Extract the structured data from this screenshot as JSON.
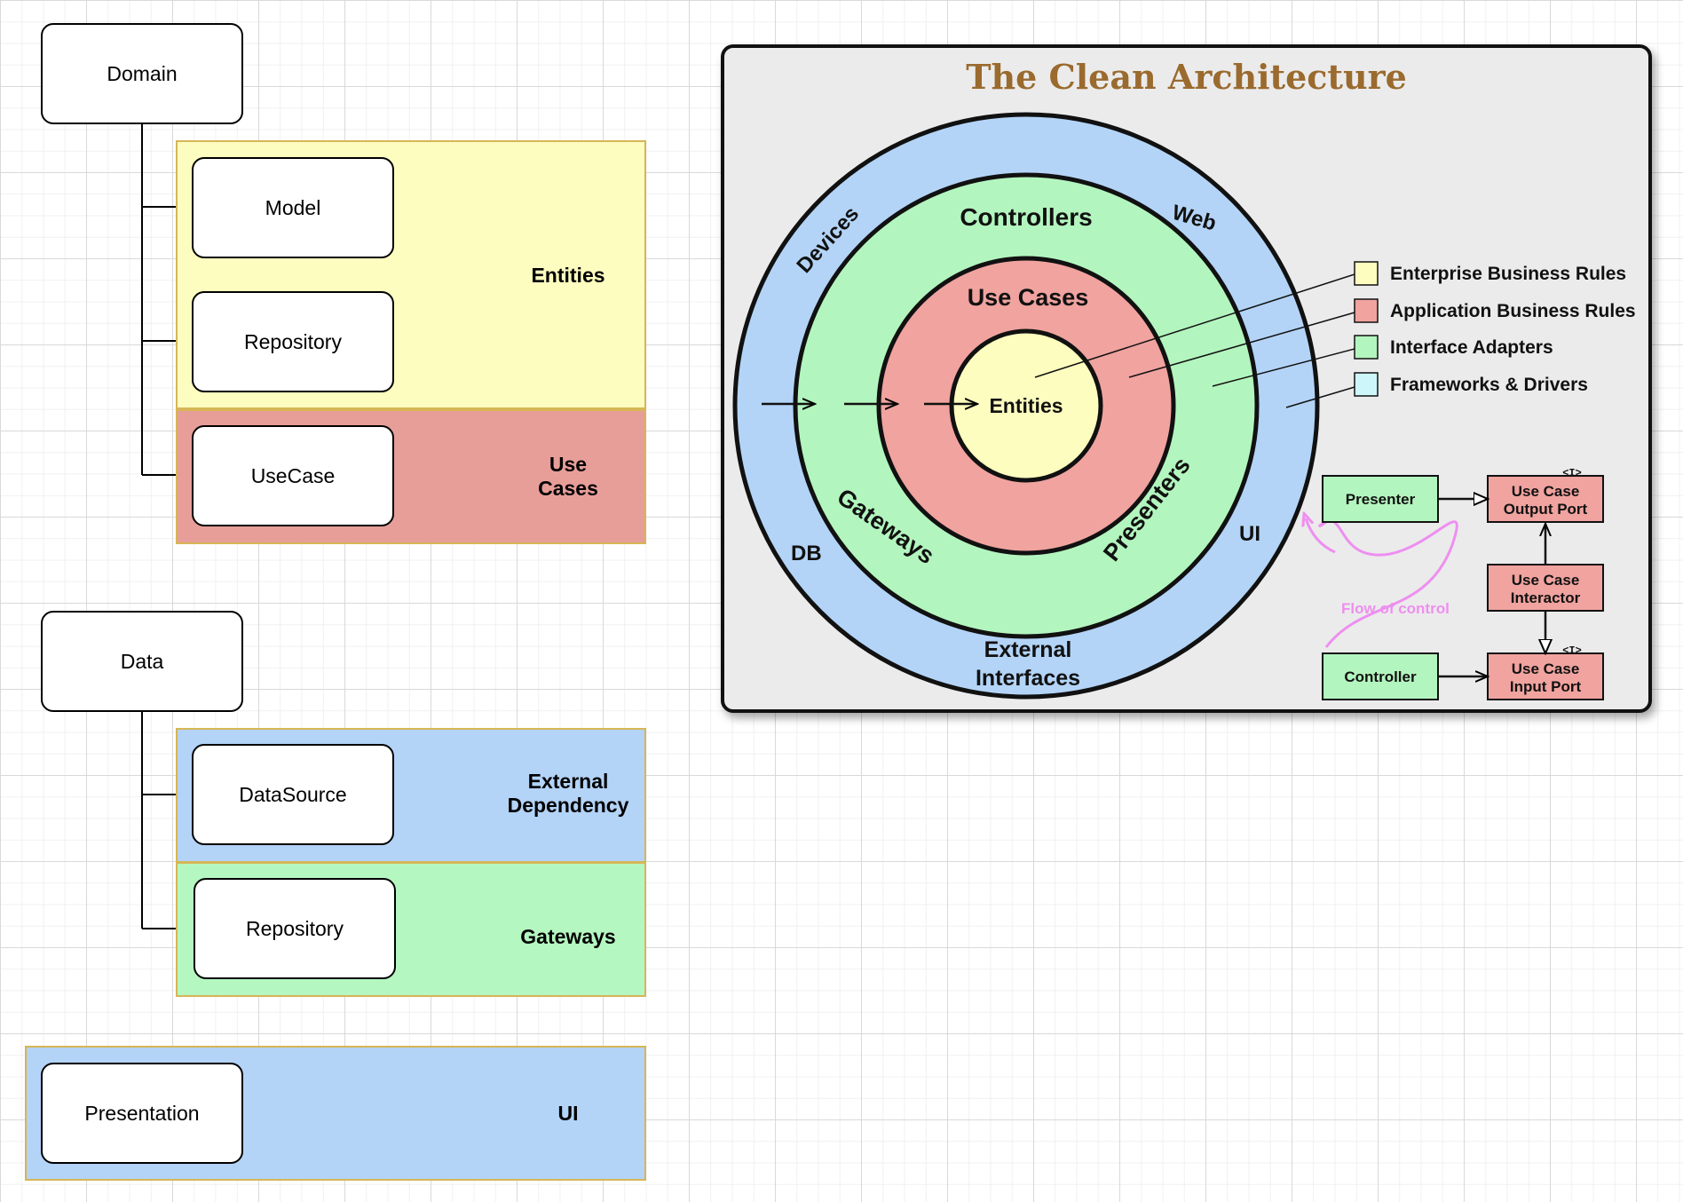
{
  "left_diagram": {
    "domain": {
      "node_label": "Domain",
      "bands": [
        {
          "label": "Entities",
          "color": "#fdfdbf",
          "children": [
            "Model",
            "Repository"
          ]
        },
        {
          "label": "Use Cases",
          "label_lines": [
            "Use",
            "Cases"
          ],
          "color": "#e79e98",
          "children": [
            "UseCase"
          ]
        }
      ]
    },
    "data": {
      "node_label": "Data",
      "bands": [
        {
          "label": "External Dependency",
          "label_lines": [
            "External",
            "Dependency"
          ],
          "color": "#b3d3f7",
          "children": [
            "DataSource"
          ]
        },
        {
          "label": "Gateways",
          "color": "#b5f7c1",
          "children": [
            "Repository"
          ]
        }
      ]
    },
    "presentation": {
      "node_label": "Presentation",
      "band": {
        "label": "UI",
        "color": "#b3d3f7"
      }
    }
  },
  "clean_architecture": {
    "title": "The Clean Architecture",
    "rings": {
      "outer": {
        "color": "#b3d4f7",
        "labels": [
          "Devices",
          "Web",
          "DB",
          "UI",
          "External",
          "Interfaces"
        ]
      },
      "adapters": {
        "color": "#b3f5be",
        "labels": [
          "Controllers",
          "Gateways",
          "Presenters"
        ]
      },
      "use_cases": {
        "color": "#f0a39f",
        "label": "Use Cases"
      },
      "entities": {
        "color": "#fdfdbf",
        "label": "Entities"
      }
    },
    "legend": [
      {
        "label": "Enterprise Business Rules",
        "color": "#fdfdbf"
      },
      {
        "label": "Application Business Rules",
        "color": "#f0a39f"
      },
      {
        "label": "Interface Adapters",
        "color": "#b3f5be"
      },
      {
        "label": "Frameworks & Drivers",
        "color": "#cdf6fb"
      }
    ],
    "flow": {
      "presenter": "Presenter",
      "controller": "Controller",
      "output_port": [
        "Use Case",
        "Output Port"
      ],
      "interactor": [
        "Use Case",
        "Interactor"
      ],
      "input_port": [
        "Use Case",
        "Input Port"
      ],
      "interface_marker": "<I>",
      "flow_label": "Flow of control",
      "flow_color": "#ee8ff0",
      "green": "#b3f5be",
      "red": "#f0a39f"
    }
  }
}
